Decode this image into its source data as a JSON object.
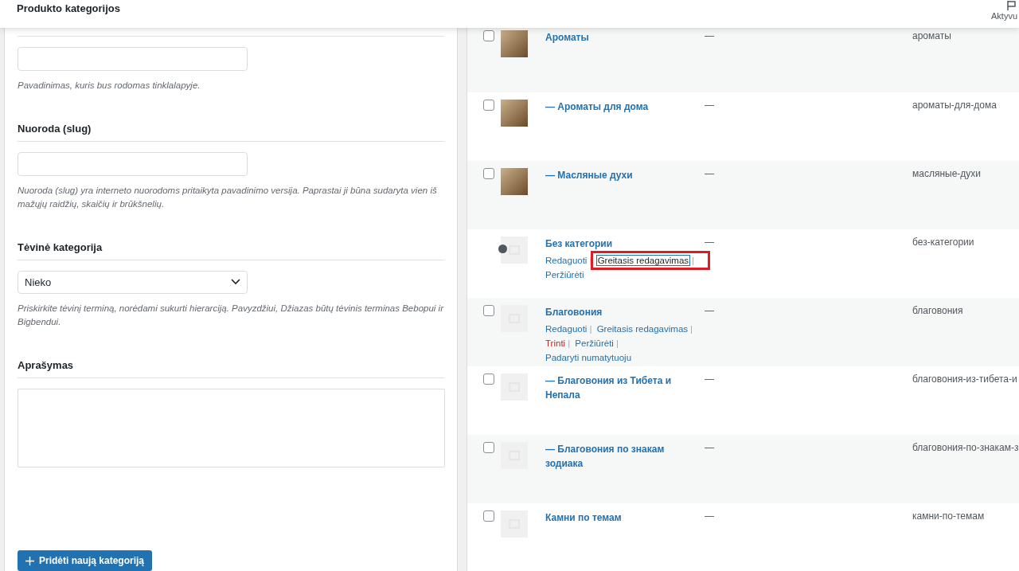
{
  "header": {
    "title": "Produkto kategorijos",
    "right_label": "Aktyvu"
  },
  "form": {
    "name_help": "Pavadinimas, kuris bus rodomas tinklalapyje.",
    "slug_label": "Nuoroda (slug)",
    "slug_help": "Nuoroda (slug) yra interneto nuorodoms pritaikyta pavadinimo versija. Paprastai ji būna sudaryta vien iš mažųjų raidžių, skaičių ir brūkšnelių.",
    "parent_label": "Tėvinė kategorija",
    "parent_value": "Nieko",
    "parent_help": "Priskirkite tėvinį terminą, norėdami sukurti hierarciją. Pavyzdžiui, Džiazas būtų tėvinis terminas Bebopui ir Bigbendui.",
    "description_label": "Aprašymas",
    "submit": "Pridėti naują kategoriją"
  },
  "table": {
    "rows": [
      {
        "name": "Ароматы",
        "description": "—",
        "slug": "ароматы",
        "has_image": true,
        "checked": false,
        "actions": []
      },
      {
        "name": "— Ароматы для дома",
        "description": "—",
        "slug": "ароматы-для-дома",
        "has_image": true,
        "checked": false,
        "actions": []
      },
      {
        "name": "— Масляные духи",
        "description": "—",
        "slug": "масляные-духи",
        "has_image": true,
        "checked": false,
        "actions": []
      },
      {
        "name": "Без категории",
        "description": "—",
        "slug": "без-категории",
        "has_image": false,
        "actions": [
          {
            "label": "Redaguoti",
            "kind": "link",
            "focused": false,
            "separator": "|"
          },
          {
            "label": "Greitasis redagavimas",
            "kind": "link",
            "focused": true,
            "separator": "|"
          },
          {
            "label": "Peržiūrėti",
            "kind": "link",
            "focused": false
          }
        ]
      },
      {
        "name": "Благовония",
        "description": "—",
        "slug": "благовония",
        "has_image": false,
        "checked": false,
        "actions": [
          {
            "label": "Redaguoti",
            "kind": "link",
            "focused": false,
            "separator": "|"
          },
          {
            "label": "Greitasis redagavimas",
            "kind": "link",
            "focused": false,
            "separator": "|"
          },
          {
            "label": "Trinti",
            "kind": "delete",
            "focused": false,
            "separator": "|"
          },
          {
            "label": "Peržiūrėti",
            "kind": "link",
            "focused": false,
            "separator": "|"
          },
          {
            "label": "Padaryti numatytuoju",
            "kind": "link",
            "focused": false
          }
        ]
      },
      {
        "name": "— Благовония из Тибета и Непала",
        "description": "—",
        "slug": "благовония-из-тибета-и",
        "has_image": false,
        "checked": false,
        "actions": []
      },
      {
        "name": "— Благовония по знакам зодиака",
        "description": "—",
        "slug": "благовония-по-знакам-з",
        "has_image": false,
        "checked": false,
        "actions": []
      },
      {
        "name": "Камни по темам",
        "description": "—",
        "slug": "камни-по-темам",
        "has_image": false,
        "checked": false,
        "actions": []
      }
    ]
  }
}
